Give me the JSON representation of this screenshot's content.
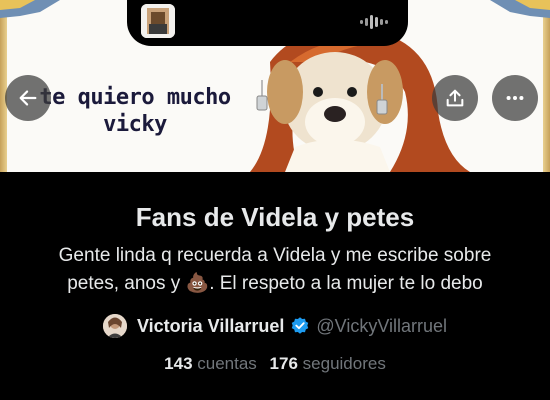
{
  "banner": {
    "text_line1": "te quiero mucho",
    "text_line2": "vicky"
  },
  "list": {
    "title": "Fans de Videla y petes",
    "description_line1": "Gente linda q recuerda a Videla y me escribe sobre",
    "description_line2_before": "petes, anos y ",
    "description_emoji": "💩",
    "description_line2_after": ". El respeto a la mujer te lo debo"
  },
  "owner": {
    "name": "Victoria Villarruel",
    "handle": "@VickyVillarruel",
    "verified": true
  },
  "stats": {
    "members_count": "143",
    "members_label": "cuentas",
    "followers_count": "176",
    "followers_label": "seguidores"
  },
  "icons": {
    "back": "arrow-left-icon",
    "share": "share-icon",
    "more": "more-horizontal-icon",
    "verified": "verified-badge-icon",
    "audio": "audio-waveform-icon"
  },
  "colors": {
    "background": "#000000",
    "primary_text": "#e7e9ea",
    "secondary_text": "#71767b",
    "verified_blue": "#1d9bf0"
  }
}
